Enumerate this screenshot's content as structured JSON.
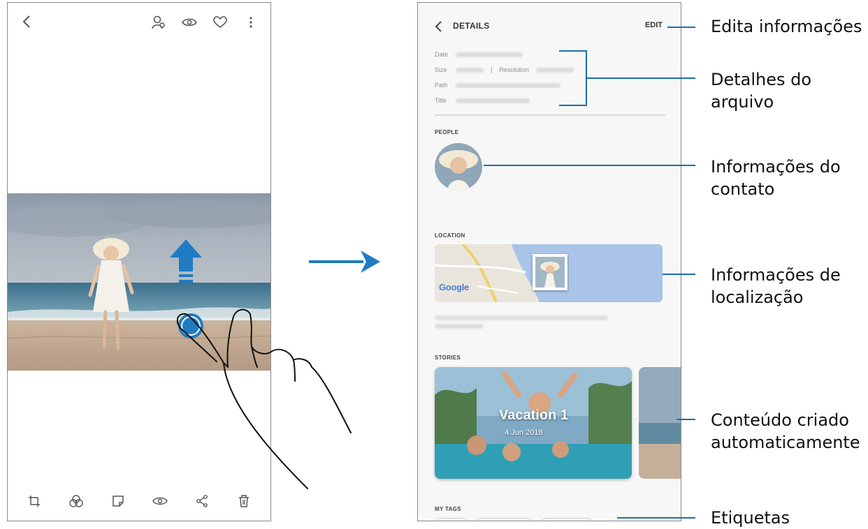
{
  "viewer": {
    "bottom_icons": [
      "crop-icon",
      "filter-icon",
      "sticker-icon",
      "eye-icon",
      "share-icon",
      "trash-icon"
    ]
  },
  "details": {
    "title": "DETAILS",
    "edit_label": "EDIT",
    "meta": {
      "date_key": "Date",
      "size_key": "Size",
      "resolution_key": "Resolution",
      "path_key": "Path",
      "title_key": "Title"
    },
    "sections": {
      "people": "PEOPLE",
      "location": "LOCATION",
      "stories": "STORIES",
      "my_tags": "MY TAGS"
    },
    "map_brand": "Google",
    "story": {
      "title": "Vacation 1",
      "date": "4 Jun 2018"
    }
  },
  "callouts": {
    "edit": "Edita informações",
    "file_details": [
      "Detalhes do",
      "arquivo"
    ],
    "contact": [
      "Informações do",
      "contato"
    ],
    "location": [
      "Informações de",
      "localização"
    ],
    "auto_content": [
      "Conteúdo criado",
      "automaticamente"
    ],
    "tags": "Etiquetas"
  },
  "colors": {
    "accent": "#1a6fa8",
    "arrow_blue": "#1f7cc2"
  }
}
